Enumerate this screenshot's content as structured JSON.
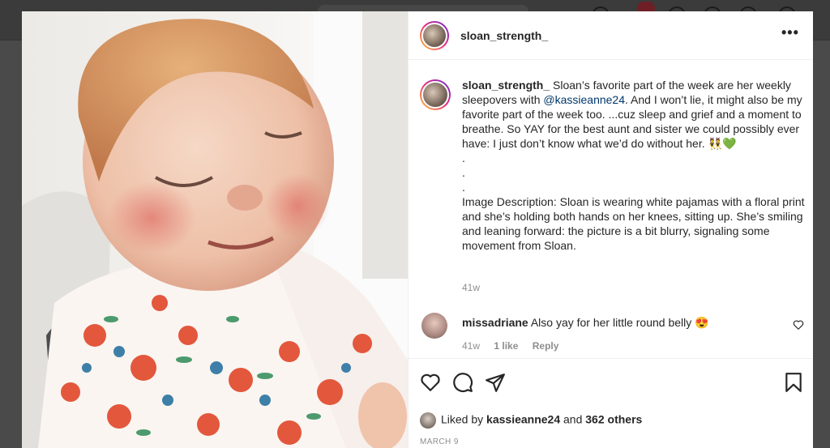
{
  "post": {
    "username": "sloan_strength_",
    "more_label": "•••"
  },
  "caption": {
    "username": "sloan_strength_",
    "text_a": " Sloan’s favorite part of the week are her weekly sleepovers with ",
    "mention": "@kassieanne24",
    "text_b": ". And I won’t lie, it might also be my favorite part of the week too. ...cuz sleep and grief and a moment to breathe. So YAY for the best aunt and sister we could possibly ever have: I just don’t know what we’d do without her. 👯💚\n.\n.\n.\nImage Description: Sloan is wearing white pajamas with a floral print and she’s holding both hands on her knees, sitting up. She’s smiling and leaning forward: the picture is a bit blurry, signaling some movement from Sloan.",
    "time": "41w"
  },
  "comment": {
    "username": "missadriane",
    "text": " Also yay for her little round belly 😍",
    "time": "41w",
    "likes": "1 like",
    "reply": "Reply"
  },
  "likes": {
    "prefix": "Liked by ",
    "user": "kassieanne24",
    "middle": " and ",
    "others": "362 others"
  },
  "date": "MARCH 9",
  "icons": [
    "heart-icon",
    "comment-icon",
    "share-icon",
    "bookmark-icon",
    "more-icon"
  ],
  "colors": {
    "link": "#00376b",
    "secondary_text": "#8e8e8e",
    "backdrop": "#4a4a4a"
  }
}
